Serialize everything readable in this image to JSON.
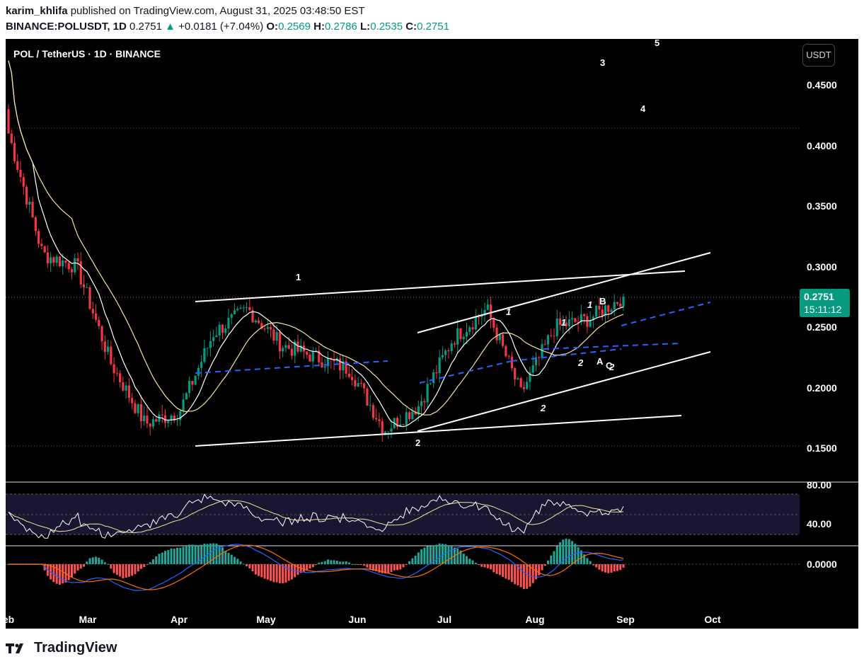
{
  "header": {
    "author": "karim_khlifa",
    "published": "published on TradingView.com, August 31, 2025 03:48:50 EST",
    "symbol": "BINANCE:POLUSDT, 1D",
    "last": "0.2751",
    "change": "+0.0181 (+7.04%)",
    "o_label": "O:",
    "o": "0.2569",
    "h_label": "H:",
    "h": "0.2786",
    "l_label": "L:",
    "l": "0.2535",
    "c_label": "C:",
    "c": "0.2751"
  },
  "chart_title": "POL / TetherUS · 1D · BINANCE",
  "currency": "USDT",
  "price_badge": {
    "price": "0.2751",
    "countdown": "15:11:12"
  },
  "colors": {
    "up": "#089981",
    "down": "#f23645",
    "ma_fast": "#ffffff",
    "ma_slow": "#f5e3a0",
    "dashed": "#2962ff",
    "trend": "#ffffff",
    "macd": "#2962ff",
    "signal": "#ff6d00"
  },
  "footer_brand": "TradingView",
  "chart_data": {
    "type": "candlestick",
    "price_ticks": [
      "0.4500",
      "0.4000",
      "0.3500",
      "0.3000",
      "0.2500",
      "0.2000",
      "0.1500"
    ],
    "rsi_ticks": [
      "80.00",
      "40.00"
    ],
    "macd_ticks": [
      "0.0000"
    ],
    "x_ticks": [
      "eb",
      "Mar",
      "Apr",
      "May",
      "Jun",
      "Jul",
      "Aug",
      "Sep",
      "Oct"
    ],
    "ylim": [
      0.135,
      0.475
    ],
    "key_points": [
      {
        "date": "Feb",
        "close": 0.41
      },
      {
        "date": "Feb mid",
        "close": 0.31
      },
      {
        "date": "Mar",
        "close": 0.3
      },
      {
        "date": "Mar mid",
        "close": 0.22
      },
      {
        "date": "Apr",
        "close": 0.17
      },
      {
        "date": "Apr mid",
        "close": 0.18
      },
      {
        "date": "Apr end",
        "close": 0.245
      },
      {
        "date": "May",
        "close": 0.265
      },
      {
        "date": "May mid",
        "close": 0.235
      },
      {
        "date": "Jun",
        "close": 0.225
      },
      {
        "date": "Jun mid",
        "close": 0.215
      },
      {
        "date": "Jun end",
        "close": 0.165
      },
      {
        "date": "Jul",
        "close": 0.185
      },
      {
        "date": "Jul mid",
        "close": 0.24
      },
      {
        "date": "Jul end",
        "close": 0.265
      },
      {
        "date": "Aug",
        "close": 0.195
      },
      {
        "date": "Aug mid",
        "close": 0.25
      },
      {
        "date": "Aug end",
        "close": 0.2569
      },
      {
        "date": "Aug 31",
        "close": 0.2751
      }
    ],
    "wave_labels": [
      "1",
      "2",
      "1",
      "2",
      "1",
      "2",
      "1",
      "2",
      "3",
      "4",
      "5",
      "A",
      "B",
      "C"
    ]
  }
}
